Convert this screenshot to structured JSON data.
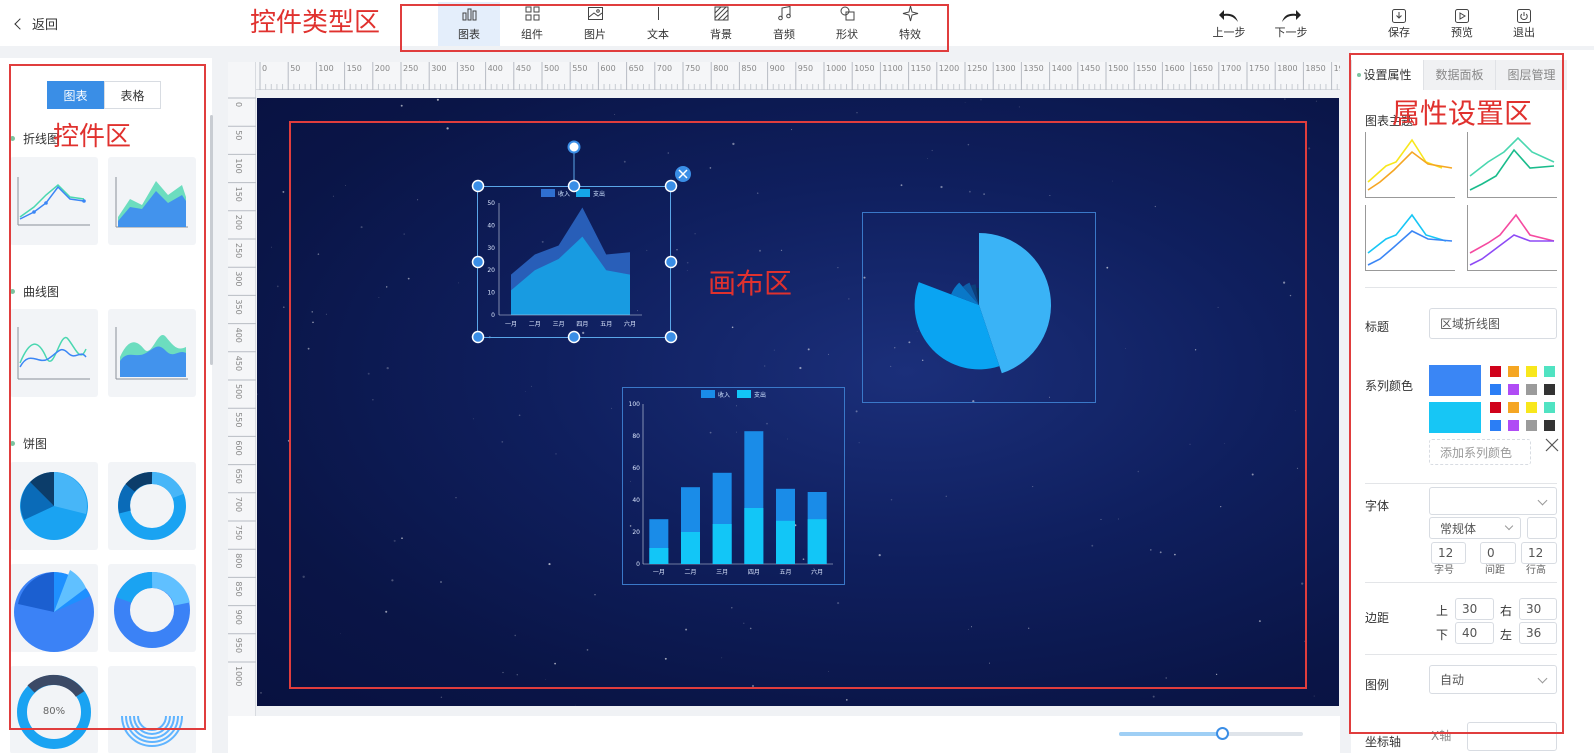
{
  "header": {
    "back_label": "返回"
  },
  "toolbar": {
    "items": [
      {
        "label": "图表",
        "icon": "bar-chart-icon",
        "active": true
      },
      {
        "label": "组件",
        "icon": "grid-icon"
      },
      {
        "label": "图片",
        "icon": "image-icon"
      },
      {
        "label": "文本",
        "icon": "text-icon"
      },
      {
        "label": "背景",
        "icon": "background-icon"
      },
      {
        "label": "音频",
        "icon": "music-icon"
      },
      {
        "label": "形状",
        "icon": "shape-icon"
      },
      {
        "label": "特效",
        "icon": "sparkle-icon"
      }
    ]
  },
  "history": {
    "undo": "上一步",
    "redo": "下一步"
  },
  "actions": {
    "save": "保存",
    "preview": "预览",
    "exit": "退出"
  },
  "annotations": {
    "toolbar": "控件类型区",
    "widgets": "控件区",
    "canvas": "画布区",
    "props": "属性设置区"
  },
  "left": {
    "seg_chart": "图表",
    "seg_table": "表格",
    "cat_line": "折线图",
    "cat_curve": "曲线图",
    "cat_pie": "饼图",
    "ring_pct": "80%"
  },
  "ruler": {
    "h": [
      "0",
      "50",
      "100",
      "150",
      "200",
      "250",
      "300",
      "350",
      "400",
      "450",
      "500",
      "550",
      "600",
      "650",
      "700",
      "750",
      "800",
      "850",
      "900",
      "950",
      "1000",
      "1050",
      "1100",
      "1150",
      "1200",
      "1250",
      "1300",
      "1350",
      "1400",
      "1450",
      "1500",
      "1550",
      "1600",
      "1650",
      "1700",
      "1750",
      "1800",
      "1850",
      "19"
    ],
    "v": [
      "0",
      "50",
      "100",
      "150",
      "200",
      "250",
      "300",
      "350",
      "400",
      "450",
      "500",
      "550",
      "600",
      "650",
      "700",
      "750",
      "800",
      "850",
      "900",
      "950",
      "1000"
    ]
  },
  "chart_data": [
    {
      "type": "area",
      "legend": [
        "收入",
        "支出"
      ],
      "categories": [
        "一月",
        "二月",
        "三月",
        "四月",
        "五月",
        "六月"
      ],
      "yticks": [
        "0",
        "10",
        "20",
        "30",
        "40",
        "50"
      ],
      "ylim": [
        0,
        50
      ],
      "series": [
        {
          "name": "收入",
          "values": [
            18,
            27,
            31,
            48,
            27,
            28
          ],
          "color": "#2f6fd0"
        },
        {
          "name": "支出",
          "values": [
            11,
            20,
            25,
            35,
            20,
            18
          ],
          "color": "#15a6e8"
        }
      ]
    },
    {
      "type": "bar",
      "legend": [
        "收入",
        "支出"
      ],
      "categories": [
        "一月",
        "二月",
        "三月",
        "四月",
        "五月",
        "六月"
      ],
      "yticks": [
        "0",
        "20",
        "40",
        "60",
        "80",
        "100"
      ],
      "ylim": [
        0,
        100
      ],
      "series": [
        {
          "name": "收入",
          "values": [
            28,
            48,
            57,
            83,
            47,
            45
          ],
          "color": "#1a8ce8"
        },
        {
          "name": "支出",
          "values": [
            10,
            20,
            25,
            35,
            27,
            28
          ],
          "color": "#12c6f7"
        }
      ]
    },
    {
      "type": "pie",
      "values": [
        35,
        28,
        6,
        4,
        3,
        2
      ],
      "colors": [
        "#3ab3f6",
        "#0aa4f2",
        "#0a78c8",
        "#0e5ea8",
        "#0c3f7a",
        "#0b2f5c"
      ]
    }
  ],
  "panel": {
    "tabs": [
      "设置属性",
      "数据面板",
      "图层管理"
    ],
    "theme_label": "图表主题",
    "title_label": "标题",
    "title_value": "区域折线图",
    "series_color_label": "系列颜色",
    "add_color": "添加系列颜色",
    "font_label": "字体",
    "font_style": "常规体",
    "font_size": "12",
    "letter": "0",
    "line": "12",
    "font_size_cap": "字号",
    "letter_cap": "间距",
    "line_cap": "行高",
    "margin_label": "边距",
    "m_top_l": "上",
    "m_top": "30",
    "m_right_l": "右",
    "m_right": "30",
    "m_bottom_l": "下",
    "m_bottom": "40",
    "m_left_l": "左",
    "m_left": "36",
    "legend_label": "图例",
    "legend_value": "自动",
    "axis_label": "坐标轴",
    "axis_x": "X轴"
  },
  "swatches": [
    "#d0021b",
    "#f5a623",
    "#f8e71c",
    "#50e3c2",
    "#2b7ef5",
    "#b04cf5",
    "#9b9b9b",
    "#333333"
  ],
  "colors": {
    "accent": "#3a8ee6",
    "series1": "#3a86f5",
    "series2": "#17c6f5"
  }
}
